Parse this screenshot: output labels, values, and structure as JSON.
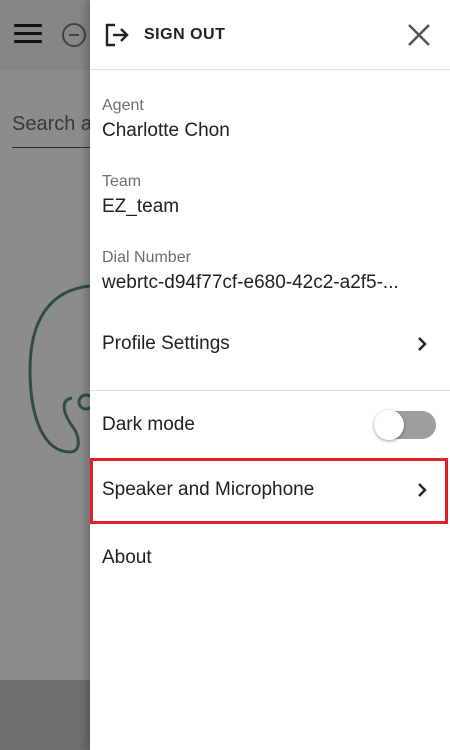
{
  "background": {
    "search_placeholder": "Search a"
  },
  "drawer": {
    "sign_out_label": "SIGN OUT",
    "agent": {
      "label": "Agent",
      "value": "Charlotte Chon"
    },
    "team": {
      "label": "Team",
      "value": "EZ_team"
    },
    "dial_number": {
      "label": "Dial Number",
      "value": "webrtc-d94f77cf-e680-42c2-a2f5-..."
    },
    "menu": {
      "profile_settings": "Profile Settings",
      "dark_mode": "Dark mode",
      "dark_mode_on": false,
      "speaker_microphone": "Speaker and Microphone",
      "about": "About"
    }
  },
  "colors": {
    "highlight": "#e01f26",
    "toggle_off_track": "#9e9e9e"
  },
  "icons": [
    "menu-icon",
    "status-icon",
    "sign-out-icon",
    "close-icon",
    "chevron-right-icon"
  ]
}
